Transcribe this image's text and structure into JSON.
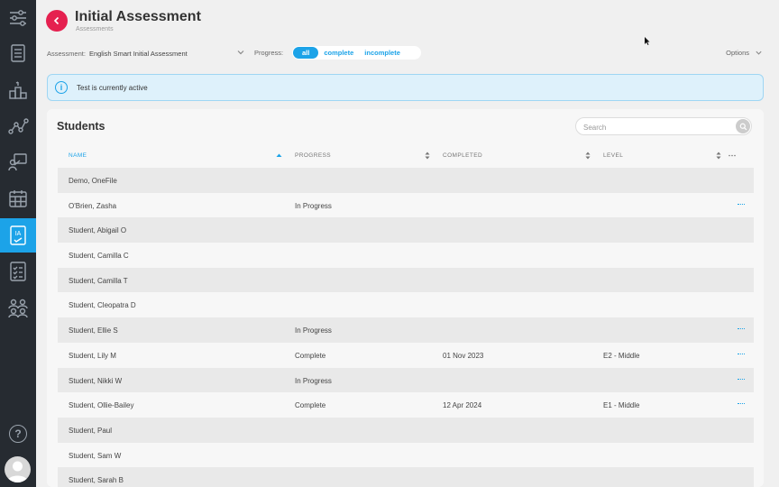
{
  "header": {
    "title": "Initial Assessment",
    "subtitle": "Assessments"
  },
  "filters": {
    "assessment_label": "Assessment:",
    "assessment_value": "English Smart Initial Assessment",
    "progress_label": "Progress:",
    "progress_options": [
      "all",
      "complete",
      "incomplete"
    ],
    "progress_selected": "all",
    "options_label": "Options"
  },
  "banner": {
    "text": "Test is currently active"
  },
  "students": {
    "title": "Students",
    "search_placeholder": "Search",
    "columns": [
      "NAME",
      "PROGRESS",
      "COMPLETED",
      "LEVEL"
    ],
    "sorted_column": "NAME",
    "rows": [
      {
        "name": "Demo, OneFile",
        "progress": "",
        "completed": "",
        "level": "",
        "menu": false
      },
      {
        "name": "O'Brien, Zasha",
        "progress": "In Progress",
        "completed": "",
        "level": "",
        "menu": true
      },
      {
        "name": "Student, Abigail O",
        "progress": "",
        "completed": "",
        "level": "",
        "menu": false
      },
      {
        "name": "Student, Camilla C",
        "progress": "",
        "completed": "",
        "level": "",
        "menu": false
      },
      {
        "name": "Student, Camilla T",
        "progress": "",
        "completed": "",
        "level": "",
        "menu": false
      },
      {
        "name": "Student, Cleopatra D",
        "progress": "",
        "completed": "",
        "level": "",
        "menu": false
      },
      {
        "name": "Student, Ellie S",
        "progress": "In Progress",
        "completed": "",
        "level": "",
        "menu": true
      },
      {
        "name": "Student, Lily M",
        "progress": "Complete",
        "completed": "01 Nov 2023",
        "level": "E2 - Middle",
        "menu": true
      },
      {
        "name": "Student, Nikki W",
        "progress": "In Progress",
        "completed": "",
        "level": "",
        "menu": true
      },
      {
        "name": "Student, Ollie-Bailey",
        "progress": "Complete",
        "completed": "12 Apr 2024",
        "level": "E1 - Middle",
        "menu": true
      },
      {
        "name": "Student, Paul",
        "progress": "",
        "completed": "",
        "level": "",
        "menu": false
      },
      {
        "name": "Student, Sam W",
        "progress": "",
        "completed": "",
        "level": "",
        "menu": false
      },
      {
        "name": "Student, Sarah B",
        "progress": "",
        "completed": "",
        "level": "",
        "menu": false
      }
    ]
  },
  "sidebar": {
    "items": [
      {
        "icon": "sliders-icon"
      },
      {
        "icon": "list-icon"
      },
      {
        "icon": "podium-icon"
      },
      {
        "icon": "network-icon"
      },
      {
        "icon": "presentation-icon"
      },
      {
        "icon": "calendar-icon"
      },
      {
        "icon": "ia-icon",
        "label": "IA",
        "active": true
      },
      {
        "icon": "checklist-icon"
      },
      {
        "icon": "people-icon"
      }
    ],
    "help_glyph": "?"
  },
  "colors": {
    "accent": "#1ca3e8",
    "brand_red": "#e5204f",
    "sidebar_bg": "#262b31"
  }
}
